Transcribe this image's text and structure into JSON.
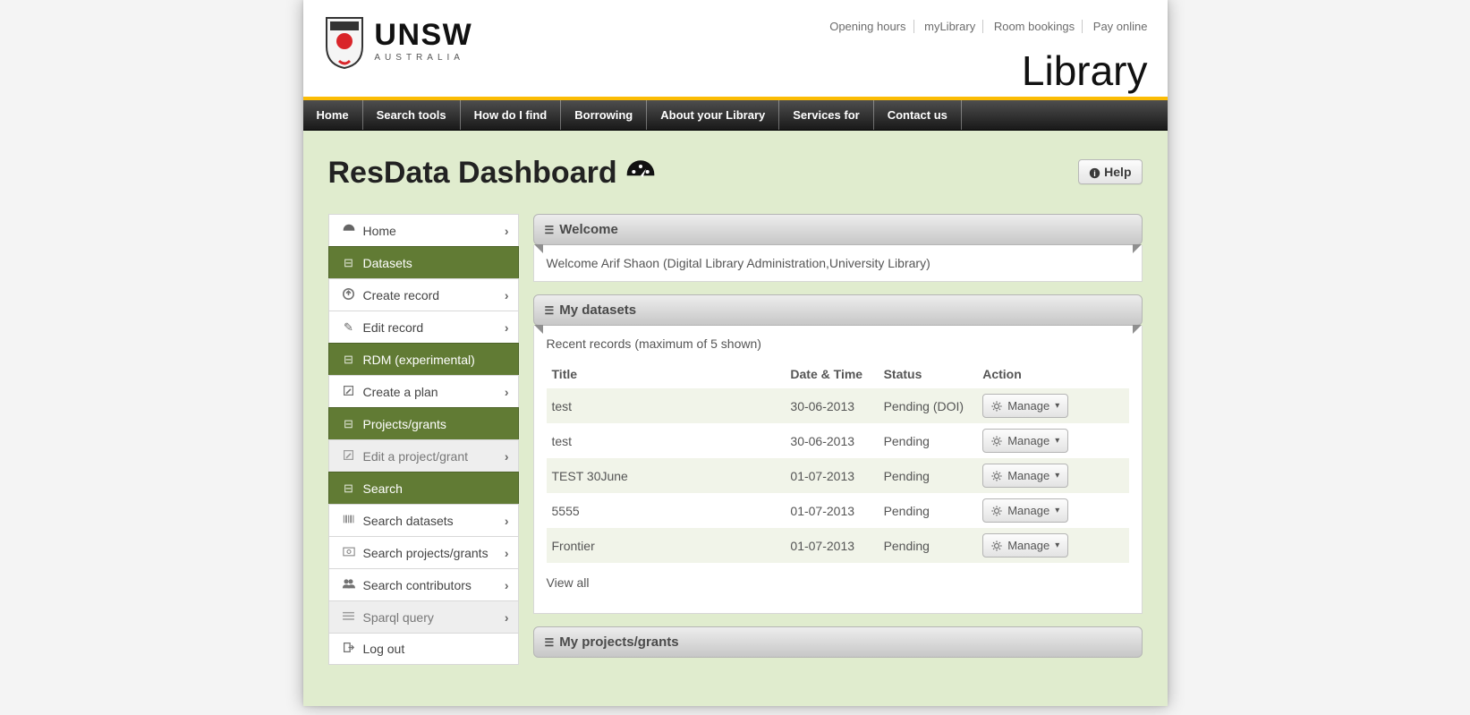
{
  "header": {
    "top_links": [
      "Opening hours",
      "myLibrary",
      "Room bookings",
      "Pay online"
    ],
    "org": "UNSW",
    "org_sub": "AUSTRALIA",
    "lib_title": "Library"
  },
  "nav": [
    "Home",
    "Search tools",
    "How do I find",
    "Borrowing",
    "About your Library",
    "Services for",
    "Contact us"
  ],
  "page_title": "ResData Dashboard",
  "help_label": "Help",
  "sidebar": {
    "home": "Home",
    "datasets": "Datasets",
    "create_record": "Create record",
    "edit_record": "Edit record",
    "rdm": "RDM (experimental)",
    "create_plan": "Create a plan",
    "projects": "Projects/grants",
    "edit_project": "Edit a project/grant",
    "search_section": "Search",
    "search_datasets": "Search datasets",
    "search_projects": "Search projects/grants",
    "search_contrib": "Search contributors",
    "sparql": "Sparql query",
    "logout": "Log out"
  },
  "welcome": {
    "title": "Welcome",
    "text": "Welcome Arif Shaon (Digital Library Administration,University Library)"
  },
  "datasets_panel": {
    "title": "My datasets",
    "recent_label": "Recent records (maximum of 5 shown)",
    "cols": {
      "title": "Title",
      "date": "Date & Time",
      "status": "Status",
      "action": "Action"
    },
    "rows": [
      {
        "title": "test",
        "date": "30-06-2013",
        "status": "Pending (DOI)"
      },
      {
        "title": "test",
        "date": "30-06-2013",
        "status": "Pending"
      },
      {
        "title": "TEST 30June",
        "date": "01-07-2013",
        "status": "Pending"
      },
      {
        "title": "5555",
        "date": "01-07-2013",
        "status": "Pending"
      },
      {
        "title": "Frontier",
        "date": "01-07-2013",
        "status": "Pending"
      }
    ],
    "manage_label": "Manage",
    "view_all": "View all"
  },
  "projects_panel": {
    "title": "My projects/grants"
  }
}
